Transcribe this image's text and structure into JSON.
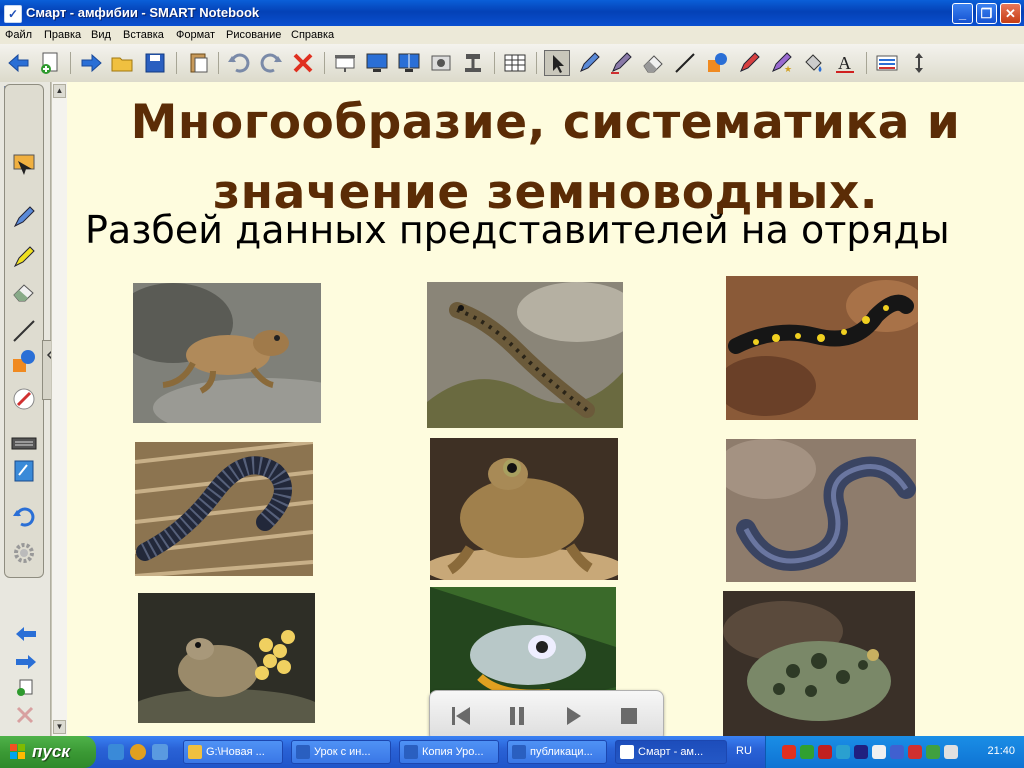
{
  "window": {
    "title": "Смарт - амфибии - SMART Notebook"
  },
  "menu": [
    "Файл",
    "Правка",
    "Вид",
    "Вставка",
    "Формат",
    "Рисование",
    "Справка"
  ],
  "toolbar_icons": [
    "back-icon",
    "add-page-icon",
    "forward-icon",
    "open-folder-icon",
    "save-icon",
    "paste-icon",
    "undo-icon",
    "redo-icon",
    "delete-icon",
    "screen-shade-icon",
    "full-screen-icon",
    "dual-page-icon",
    "screen-capture-icon",
    "document-camera-icon",
    "table-icon",
    "select-icon",
    "pen-icon",
    "creative-pen-icon",
    "eraser-icon",
    "line-icon",
    "shapes-icon",
    "magic-pen-icon",
    "fill-icon",
    "text-icon",
    "properties-icon",
    "toolbar-move-icon"
  ],
  "page": {
    "title": "Многообразие, систематика и значение земноводных.",
    "instruction": "Разбей данных представителей на отряды"
  },
  "photos": [
    {
      "name": "frog",
      "bg": "#8a8a84",
      "body": "#b08a5a"
    },
    {
      "name": "newt",
      "bg": "#9a9688",
      "body": "#6b5a3a"
    },
    {
      "name": "fire-salamander",
      "bg": "#8a5a3a",
      "body": "#1a1a1a"
    },
    {
      "name": "caecilian-ringed",
      "bg": "#a08860",
      "body": "#2a3040"
    },
    {
      "name": "toad-brown",
      "bg": "#4a3a2a",
      "body": "#a08050"
    },
    {
      "name": "caecilian-blue",
      "bg": "#8a7868",
      "body": "#485070"
    },
    {
      "name": "midwife-toad",
      "bg": "#3a3a30",
      "body": "#9a8a6a"
    },
    {
      "name": "tree-frog",
      "bg": "#2a5a2a",
      "body": "#b8c8c8"
    },
    {
      "name": "green-toad",
      "bg": "#3a3028",
      "body": "#6a7a5a"
    }
  ],
  "taskbar": {
    "start_label": "пуск",
    "tasks": [
      "G:\\Новая ...",
      "Урок с ин...",
      "Копия Уро...",
      "публикаци...",
      "Смарт - ам..."
    ],
    "language": "RU",
    "clock": "21:40"
  },
  "colors": {
    "canvas": "#fefcde",
    "title": "#5b2c06",
    "titlebar": "#0441b6",
    "taskbar": "#2a62d6"
  }
}
